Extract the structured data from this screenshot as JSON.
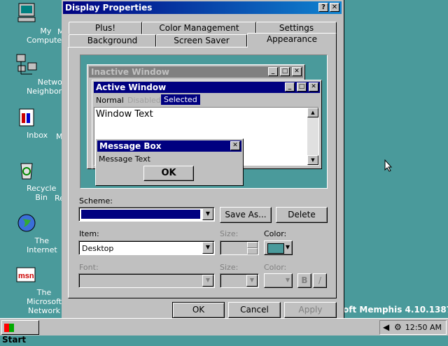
{
  "desktop": {
    "icons": [
      {
        "label": "My Computer"
      },
      {
        "label": "Network\nNeighborhood"
      },
      {
        "label": "Inbox"
      },
      {
        "label": "Recycle Bin"
      },
      {
        "label": "The Internet"
      },
      {
        "label": "The Microsoft\nNetwork"
      }
    ],
    "partial_labels": [
      "M",
      "M",
      "Re"
    ],
    "version_text": "oft Memphis 4.10.1387"
  },
  "dialog": {
    "title": "Display Properties",
    "title_buttons": {
      "help": "?",
      "close": "✕"
    },
    "tabs_row1": [
      "Plus!",
      "Color Management",
      "Settings"
    ],
    "tabs_row2": [
      "Background",
      "Screen Saver",
      "Appearance"
    ],
    "active_tab": "Appearance",
    "preview": {
      "inactive_title": "Inactive Window",
      "active_title": "Active Window",
      "menu": {
        "normal": "Normal",
        "disabled": "Disabled",
        "selected": "Selected"
      },
      "window_text": "Window Text",
      "message_box_title": "Message Box",
      "message_text": "Message Text",
      "ok_label": "OK"
    },
    "scheme": {
      "label": "Scheme:",
      "value": "",
      "save_as": "Save As...",
      "delete": "Delete"
    },
    "item": {
      "label": "Item:",
      "value": "Desktop",
      "size_label": "Size:",
      "color_label": "Color:",
      "color_value": "#4a9a9b"
    },
    "font": {
      "label": "Font:",
      "size_label": "Size:",
      "color_label": "Color:",
      "bold": "B",
      "italic": "/"
    },
    "footer": {
      "ok": "OK",
      "cancel": "Cancel",
      "apply": "Apply"
    }
  },
  "taskbar": {
    "start_label": "Start",
    "clock": "12:50 AM"
  },
  "colors": {
    "desktop": "#4a9a9b",
    "active_title": "#000080",
    "selection": "#000080"
  }
}
